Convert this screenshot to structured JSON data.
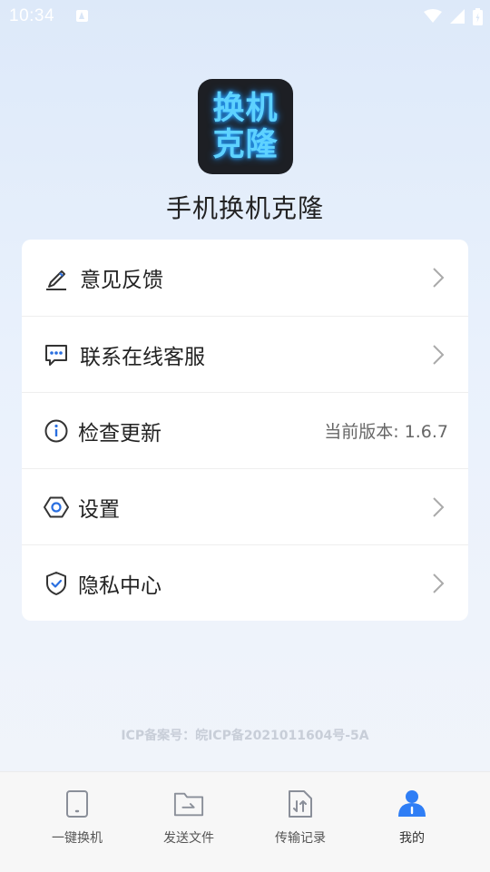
{
  "status_bar": {
    "time": "10:34"
  },
  "app": {
    "logo_line1": "换机",
    "logo_line2": "克隆",
    "name": "手机换机克隆"
  },
  "menu": {
    "items": [
      {
        "label": "意见反馈",
        "icon": "pencil-icon"
      },
      {
        "label": "联系在线客服",
        "icon": "chat-bubble-icon"
      },
      {
        "label": "检查更新",
        "icon": "info-icon",
        "value": "当前版本: 1.6.7"
      },
      {
        "label": "设置",
        "icon": "hexagon-settings-icon"
      },
      {
        "label": "隐私中心",
        "icon": "shield-check-icon"
      }
    ]
  },
  "footer": {
    "icp": "ICP备案号：皖ICP备2021011604号-5A"
  },
  "bottom_nav": {
    "items": [
      {
        "label": "一键换机",
        "icon": "phone-icon",
        "active": false
      },
      {
        "label": "发送文件",
        "icon": "folder-send-icon",
        "active": false
      },
      {
        "label": "传输记录",
        "icon": "file-transfer-icon",
        "active": false
      },
      {
        "label": "我的",
        "icon": "user-icon",
        "active": true
      }
    ]
  },
  "colors": {
    "accent": "#2f7ef5",
    "logo_bg": "#1d1f24",
    "logo_text": "#5ed2ff",
    "icon_dark": "#333333",
    "icon_blue": "#2a6fe0"
  }
}
